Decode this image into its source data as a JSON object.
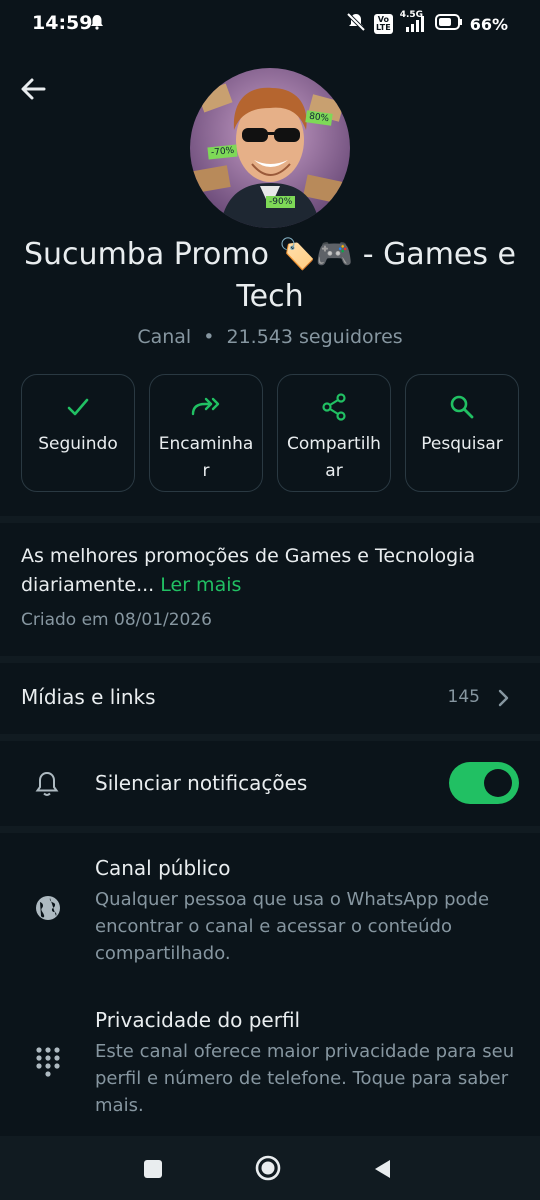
{
  "status": {
    "time": "14:59",
    "signal_label": "4.5G",
    "volte_label": "Vo\nLTE",
    "battery": "66%"
  },
  "channel": {
    "name": "Sucumba Promo 🏷️🎮  - Games e Tech",
    "type": "Canal",
    "separator": "•",
    "followers": "21.543 seguidores",
    "avatar_tags": [
      "80%",
      "-70%",
      "-90%"
    ]
  },
  "actions": [
    {
      "label": "Seguindo",
      "icon": "check-icon"
    },
    {
      "label": "Encaminhar",
      "icon": "forward-icon"
    },
    {
      "label": "Compartilhar",
      "icon": "share-icon"
    },
    {
      "label": "Pesquisar",
      "icon": "search-icon"
    }
  ],
  "about": {
    "description": "As melhores promoções de Games e Tecnologia diariamente...",
    "read_more": "Ler mais",
    "created": "Criado em 08/01/2026"
  },
  "media": {
    "label": "Mídias e links",
    "count": "145"
  },
  "mute": {
    "label": "Silenciar notificações",
    "enabled": true
  },
  "public_channel": {
    "title": "Canal público",
    "text": "Qualquer pessoa que usa o WhatsApp pode encontrar o canal e acessar o conteúdo compartilhado."
  },
  "privacy": {
    "title": "Privacidade do perfil",
    "text": "Este canal oferece maior privacidade para seu perfil e número de telefone. Toque para saber mais."
  },
  "colors": {
    "accent": "#21c063",
    "background": "#0b141a",
    "secondary_text": "#8696a0"
  }
}
